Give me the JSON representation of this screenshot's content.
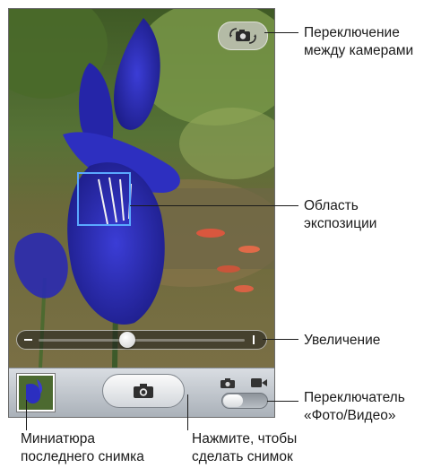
{
  "screen": {
    "scene": "iris-flower-garden",
    "zoom_level": 0.42,
    "capture_mode": "photo"
  },
  "controls": {
    "switch_camera_icon": "camera-rotate-icon",
    "shutter_icon": "camera-icon",
    "photo_mode_icon": "camera-icon",
    "video_mode_icon": "video-camera-icon",
    "exposure_box_color": "#5aa8ff"
  },
  "callouts": {
    "switch_camera": "Переключение\nмежду камерами",
    "exposure_area": "Область\nэкспозиции",
    "zoom": "Увеличение",
    "mode_switch": "Переключатель\n«Фото/Видео»",
    "last_photo": "Миниатюра\nпоследнего снимка",
    "take_photo": "Нажмите, чтобы\nсделать снимок"
  }
}
